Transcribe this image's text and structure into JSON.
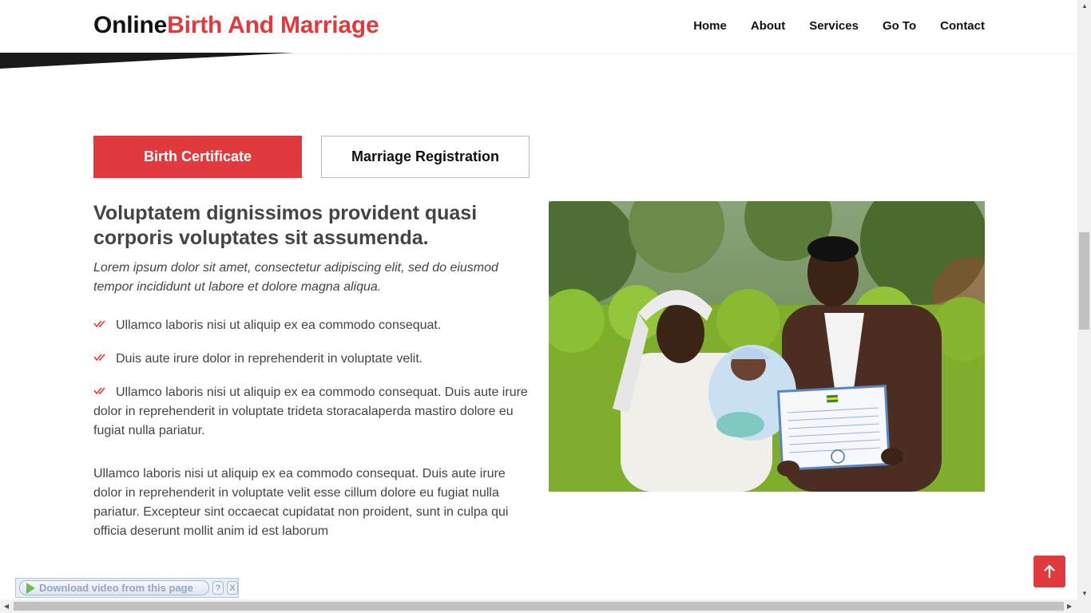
{
  "header": {
    "logo_primary": "Online",
    "logo_accent": "Birth And Marriage",
    "nav": [
      "Home",
      "About",
      "Services",
      "Go To",
      "Contact"
    ]
  },
  "tabs": {
    "birth": "Birth Certificate",
    "marriage": "Marriage Registration",
    "active": "Birth Certificate"
  },
  "content": {
    "heading": "Voluptatem dignissimos provident quasi corporis voluptates sit assumenda.",
    "lead": "Lorem ipsum dolor sit amet, consectetur adipiscing elit, sed do eiusmod tempor incididunt ut labore et dolore magna aliqua.",
    "checklist": [
      "Ullamco laboris nisi ut aliquip ex ea commodo consequat.",
      "Duis aute irure dolor in reprehenderit in voluptate velit.",
      "Ullamco laboris nisi ut aliquip ex ea commodo consequat. Duis aute irure dolor in reprehenderit in voluptate trideta storacalaperda mastiro dolore eu fugiat nulla pariatur."
    ],
    "paragraph": "Ullamco laboris nisi ut aliquip ex ea commodo consequat. Duis aute irure dolor in reprehenderit in voluptate velit esse cillum dolore eu fugiat nulla pariatur. Excepteur sint occaecat cupidatat non proident, sunt in culpa qui officia deserunt mollit anim id est laborum"
  },
  "download_bar": {
    "label": "Download video from this page",
    "help": "?",
    "close": "X"
  },
  "colors": {
    "accent": "#e03a3e",
    "text": "#444444",
    "nav_text": "#111111"
  },
  "icons": {
    "back_to_top": "arrow-up-icon",
    "check": "double-check-icon"
  }
}
